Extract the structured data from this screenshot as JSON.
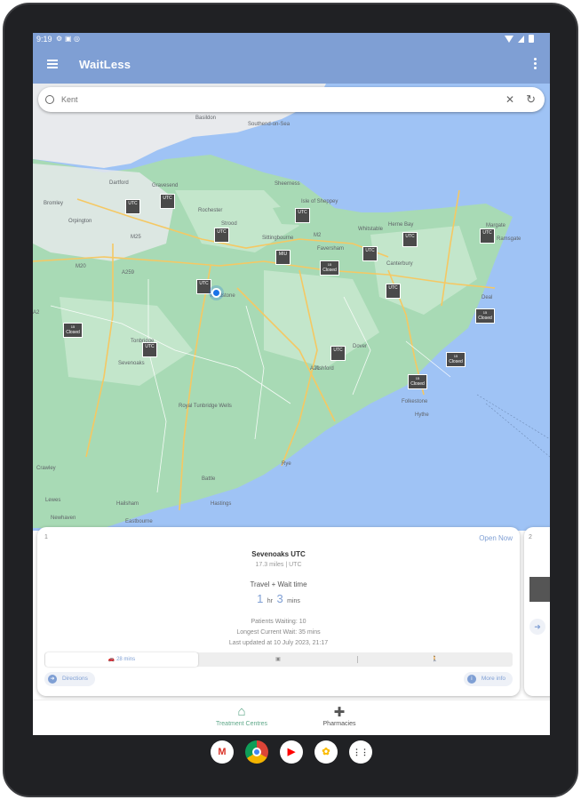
{
  "status_bar": {
    "time": "9:19"
  },
  "app_bar": {
    "title": "WaitLess"
  },
  "search": {
    "value": "",
    "placeholder": "Kent"
  },
  "map": {
    "markers": [
      {
        "top": "",
        "label": "UTC"
      },
      {
        "top": "",
        "label": "UTC"
      },
      {
        "top": "",
        "label": "UTC"
      },
      {
        "top": "",
        "label": "UTC"
      },
      {
        "top": "",
        "label": "UTC"
      },
      {
        "top": "",
        "label": "UTC"
      },
      {
        "top": "",
        "label": "UTC"
      },
      {
        "top": "",
        "label": "UTC"
      },
      {
        "top": "",
        "label": "MIU"
      },
      {
        "top": "",
        "label": "UTC"
      },
      {
        "top": "",
        "label": "UTC"
      },
      {
        "top": "",
        "label": "UTC"
      },
      {
        "top": "15",
        "label": "Closed"
      },
      {
        "top": "15",
        "label": "Closed"
      },
      {
        "top": "15",
        "label": "Closed"
      },
      {
        "top": "15",
        "label": "Closed"
      },
      {
        "top": "15",
        "label": "Closed"
      }
    ],
    "place_labels": [
      "Basildon",
      "Southend-on-Sea",
      "Dartford",
      "Gravesend",
      "Bromley",
      "Orpington",
      "Rochester",
      "Sheerness",
      "Isle of Sheppey",
      "Strood",
      "Sittingbourne",
      "Faversham",
      "Whitstable",
      "Herne Bay",
      "Margate",
      "Ramsgate",
      "Canterbury",
      "Deal",
      "Dover",
      "Folkestone",
      "Ashford",
      "Maidstone",
      "Tonbridge",
      "Royal Tunbridge Wells",
      "Sevenoaks",
      "Hythe",
      "Rye",
      "Hastings",
      "Battle",
      "Hailsham",
      "Eastbourne",
      "Lewes",
      "Newhaven",
      "Crawley",
      "M25",
      "M20",
      "M2",
      "A2",
      "A21",
      "A259"
    ]
  },
  "card": {
    "index": "1",
    "open_status": "Open Now",
    "name": "Sevenoaks UTC",
    "distance": "17.3 miles | UTC",
    "travel_wait_label": "Travel + Wait time",
    "travel_hr": "1",
    "hr_unit": "hr",
    "travel_min": "3",
    "min_unit": "mins",
    "patients_waiting": "Patients Waiting: 10",
    "longest_wait": "Longest Current Wait: 35 mins",
    "last_updated": "Last updated at 10 July 2023, 21:17",
    "modes": {
      "car_label": "28 mins",
      "bus_icon": "bus-icon",
      "walk_icon": "walk-icon"
    },
    "directions_label": "Directions",
    "more_info_label": "More info"
  },
  "card2": {
    "index": "2"
  },
  "bottom_nav": {
    "treatment_centres": "Treatment Centres",
    "pharmacies": "Pharmacies"
  },
  "dock_apps": [
    "Gmail",
    "Chrome",
    "YouTube",
    "Photos",
    "Apps"
  ],
  "colors": {
    "accent": "#7f9fd4",
    "active_nav": "#5fa889",
    "map_land": "#a8dab5",
    "map_sea": "#9fc3f5"
  }
}
